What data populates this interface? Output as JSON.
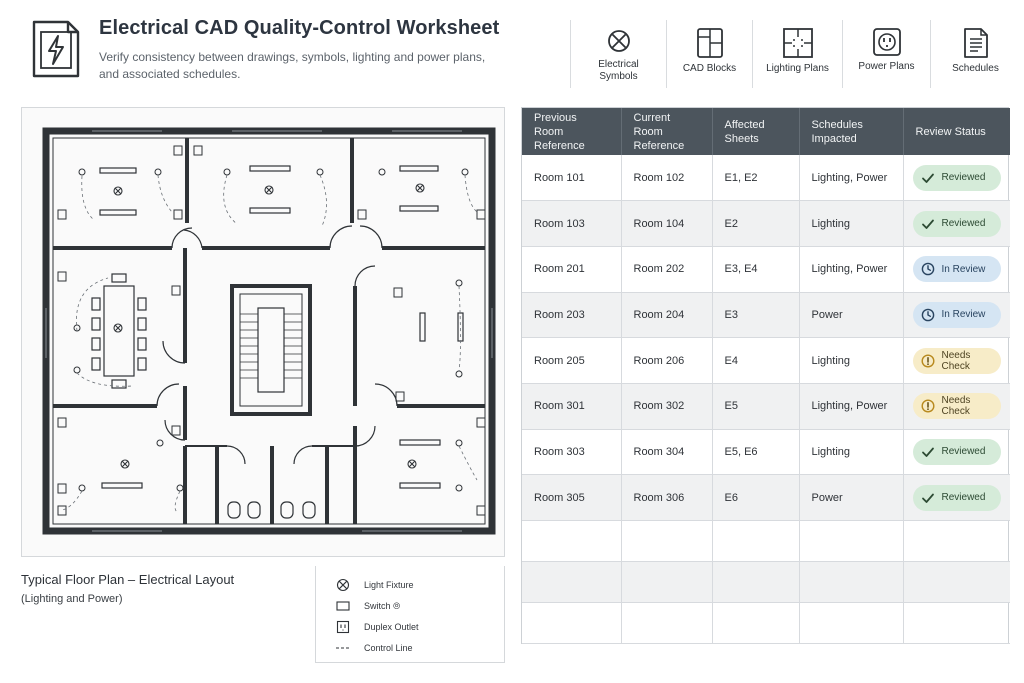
{
  "header": {
    "title": "Electrical CAD Quality-Control Worksheet",
    "subtitle": "Verify consistency between drawings, symbols, lighting and power plans, and associated schedules.",
    "icon": "lightning-document-icon"
  },
  "toolbar": {
    "items": [
      {
        "label": "Electrical Symbols",
        "icon": "circle-x-symbol-icon"
      },
      {
        "label": "CAD Blocks",
        "icon": "cad-blocks-icon"
      },
      {
        "label": "Lighting Plans",
        "icon": "lighting-plan-icon"
      },
      {
        "label": "Power Plans",
        "icon": "power-outlet-icon"
      },
      {
        "label": "Schedules",
        "icon": "schedule-document-icon"
      }
    ]
  },
  "plan": {
    "title": "Typical Floor Plan – Electrical Layout",
    "subtitle": "(Lighting and Power)"
  },
  "legend": {
    "items": [
      {
        "label": "Light Fixture",
        "icon": "light-fixture-icon"
      },
      {
        "label": "Switch ⦾",
        "icon": "switch-icon"
      },
      {
        "label": "Duplex Outlet",
        "icon": "duplex-outlet-icon"
      },
      {
        "label": "Control Line",
        "icon": "control-line-icon"
      }
    ]
  },
  "table": {
    "headers": [
      "Previous Room Reference",
      "Current Room Reference",
      "Affected Sheets",
      "Schedules Impacted",
      "Review Status"
    ],
    "rows": [
      {
        "prev": "Room 101",
        "curr": "Room 102",
        "sheets": "E1, E2",
        "schedules": "Lighting, Power",
        "status": "Reviewed"
      },
      {
        "prev": "Room 103",
        "curr": "Room 104",
        "sheets": "E2",
        "schedules": "Lighting",
        "status": "Reviewed"
      },
      {
        "prev": "Room 201",
        "curr": "Room 202",
        "sheets": "E3, E4",
        "schedules": "Lighting, Power",
        "status": "In Review"
      },
      {
        "prev": "Room 203",
        "curr": "Room 204",
        "sheets": "E3",
        "schedules": "Power",
        "status": "In Review"
      },
      {
        "prev": "Room 205",
        "curr": "Room 206",
        "sheets": "E4",
        "schedules": "Lighting",
        "status": "Needs Check"
      },
      {
        "prev": "Room 301",
        "curr": "Room 302",
        "sheets": "E5",
        "schedules": "Lighting, Power",
        "status": "Needs Check"
      },
      {
        "prev": "Room 303",
        "curr": "Room 304",
        "sheets": "E5, E6",
        "schedules": "Lighting",
        "status": "Reviewed"
      },
      {
        "prev": "Room 305",
        "curr": "Room 306",
        "sheets": "E6",
        "schedules": "Power",
        "status": "Reviewed"
      }
    ],
    "empty_rows": 3
  },
  "colors": {
    "header_bg": "#4c555d",
    "reviewed": "#d5ebd9",
    "in_review": "#d5e5f3",
    "needs_check": "#f7ecc8",
    "wall": "#2f3337"
  }
}
